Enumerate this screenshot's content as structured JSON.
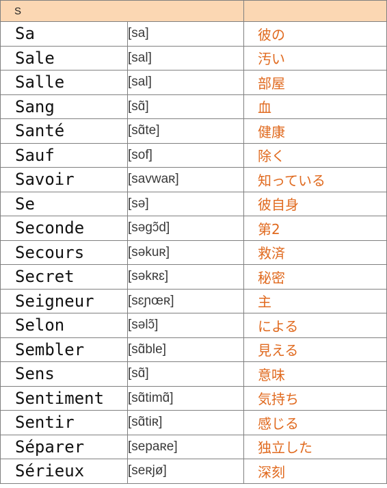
{
  "header": {
    "letter": "S",
    "meaning_header": ""
  },
  "entries": [
    {
      "word": "Sa",
      "ipa": "[sa]",
      "meaning": "彼の"
    },
    {
      "word": "Sale",
      "ipa": "[sal]",
      "meaning": "汚い"
    },
    {
      "word": "Salle",
      "ipa": "[sal]",
      "meaning": "部屋"
    },
    {
      "word": "Sang",
      "ipa": "[sɑ̃]",
      "meaning": "血"
    },
    {
      "word": "Santé",
      "ipa": "[sɑ̃te]",
      "meaning": "健康"
    },
    {
      "word": "Sauf",
      "ipa": "[sof]",
      "meaning": "除く"
    },
    {
      "word": "Savoir",
      "ipa": "[savwaʀ]",
      "meaning": "知っている"
    },
    {
      "word": "Se",
      "ipa": "[sə]",
      "meaning": "彼自身"
    },
    {
      "word": "Seconde",
      "ipa": "[səgɔ̃d]",
      "meaning": "第2"
    },
    {
      "word": "Secours",
      "ipa": "[səkuʀ]",
      "meaning": "救済"
    },
    {
      "word": "Secret",
      "ipa": "[səkʀɛ]",
      "meaning": "秘密"
    },
    {
      "word": "Seigneur",
      "ipa": "[sɛɲœʀ]",
      "meaning": "主"
    },
    {
      "word": "Selon",
      "ipa": "[səlɔ̃]",
      "meaning": "による"
    },
    {
      "word": "Sembler",
      "ipa": "[sɑ̃ble]",
      "meaning": "見える"
    },
    {
      "word": "Sens",
      "ipa": "[sɑ̃]",
      "meaning": "意味"
    },
    {
      "word": "Sentiment",
      "ipa": "[sɑ̃timɑ̃]",
      "meaning": "気持ち"
    },
    {
      "word": "Sentir",
      "ipa": "[sɑ̃tiʀ]",
      "meaning": "感じる"
    },
    {
      "word": "Séparer",
      "ipa": "[sepaʀe]",
      "meaning": "独立した"
    },
    {
      "word": "Sérieux",
      "ipa": "[seʀjø]",
      "meaning": "深刻"
    }
  ],
  "colors": {
    "header_bg": "#fbd7b3",
    "meaning_text": "#e06a1f",
    "grid_line": "#7f7f7f"
  }
}
